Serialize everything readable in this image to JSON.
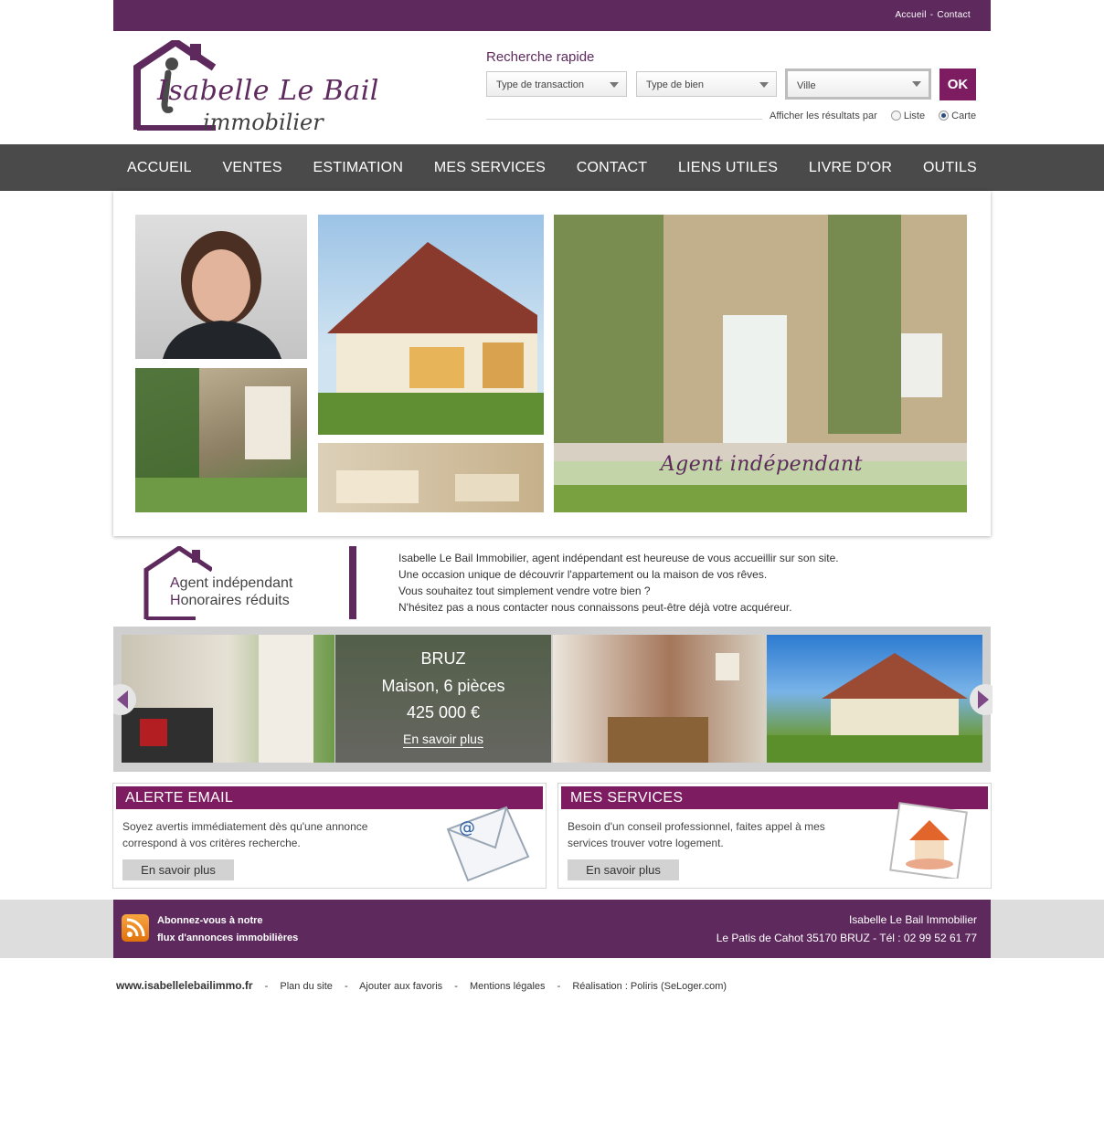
{
  "colors": {
    "brand": "#5e2a5e",
    "accent": "#7d1c60",
    "nav": "#4a4a4a"
  },
  "topbar": {
    "links": [
      "Accueil",
      "Contact"
    ],
    "separator": "-"
  },
  "logo": {
    "title": "Isabelle Le Bail",
    "subtitle": "immobilier"
  },
  "search": {
    "title": "Recherche rapide",
    "transaction": "Type de transaction",
    "bien": "Type de bien",
    "ville": "Ville",
    "ok": "OK",
    "display_label": "Afficher les résultats par",
    "option_list": "Liste",
    "option_map": "Carte",
    "selected": "Carte"
  },
  "nav": [
    "ACCUEIL",
    "VENTES",
    "ESTIMATION",
    "MES SERVICES",
    "CONTACT",
    "LIENS UTILES",
    "LIVRE D'OR",
    "OUTILS"
  ],
  "hero": {
    "caption": "Agent indépendant"
  },
  "badge": {
    "l1_initial": "A",
    "l1_rest": "gent indépendant",
    "l2_initial": "H",
    "l2_rest": "onoraires réduits"
  },
  "intro": [
    "Isabelle Le Bail Immobilier, agent indépendant est heureuse de vous accueillir sur son site.",
    "Une occasion unique de découvrir l'appartement ou la maison de vos rêves.",
    "Vous souhaitez tout simplement vendre votre bien ?",
    "N'hésitez pas a nous contacter nous connaissons peut-être déjà votre acquéreur."
  ],
  "listing": {
    "city": "BRUZ",
    "type": "Maison, 6 pièces",
    "price": "425 000 €",
    "more": "En savoir plus"
  },
  "alert_box": {
    "title": "ALERTE EMAIL",
    "text": "Soyez avertis immédiatement dès qu'une annonce correspond à vos critères recherche.",
    "button": "En savoir plus"
  },
  "services_box": {
    "title": "MES SERVICES",
    "text": "Besoin d'un conseil professionnel, faites appel à mes services trouver votre logement.",
    "button": "En savoir plus"
  },
  "footer": {
    "rss_l1": "Abonnez-vous à notre",
    "rss_l2": "flux d'annonces immobilières",
    "company": "Isabelle Le Bail Immobilier",
    "address": "Le Patis de Cahot 35170 BRUZ - Tél : 02 99 52 61 77"
  },
  "bottom": {
    "site": "www.isabellelebailimmo.fr",
    "links": [
      "Plan du site",
      "Ajouter aux favoris",
      "Mentions légales",
      "Réalisation : Poliris (SeLoger.com)"
    ],
    "separator": "-"
  }
}
